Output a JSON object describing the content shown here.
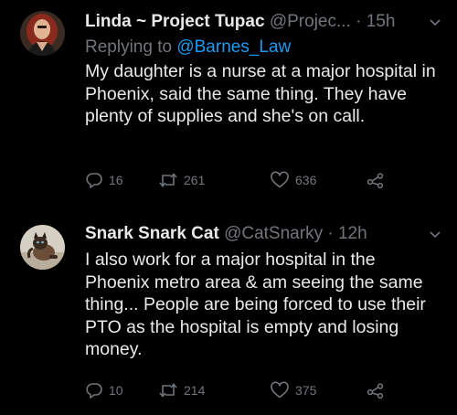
{
  "tweets": [
    {
      "name": "Linda ~ Project Tupac",
      "handle": "@Projec...",
      "separator": "·",
      "time": "15h",
      "reply_prefix": "Replying to",
      "reply_to": "@Barnes_Law",
      "text": "My daughter is a nurse at a major hospital in Phoenix, said the same thing. They have plenty of supplies and she's on call.",
      "replies": "16",
      "retweets": "261",
      "likes": "636"
    },
    {
      "name": "Snark Snark Cat",
      "handle": "@CatSnarky",
      "separator": "·",
      "time": "12h",
      "text": "I also work for a major hospital in the Phoenix metro area & am seeing the same thing... People are being forced to use their PTO as the hospital is empty and losing money.",
      "replies": "10",
      "retweets": "214",
      "likes": "375"
    }
  ],
  "icons": {
    "reply": "reply-icon",
    "retweet": "retweet-icon",
    "like": "heart-icon",
    "share": "share-icon",
    "more": "chevron-down-icon"
  },
  "colors": {
    "background": "#000000",
    "text": "#e7e9ea",
    "muted": "#71767b",
    "link": "#1d9bf0"
  }
}
